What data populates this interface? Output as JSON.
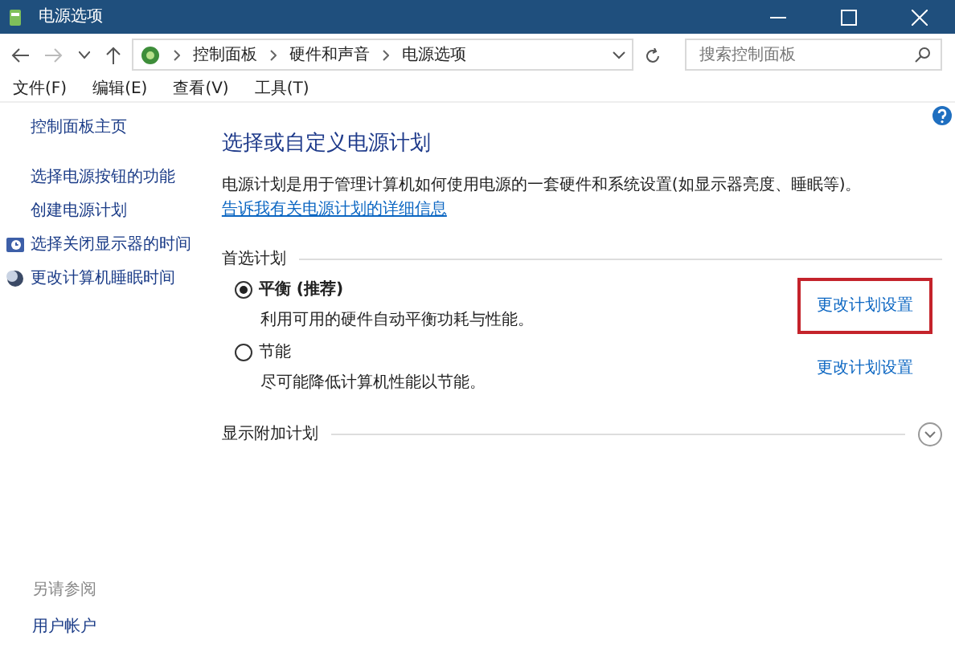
{
  "window": {
    "title": "电源选项"
  },
  "address_bar": {
    "crumbs": [
      "控制面板",
      "硬件和声音",
      "电源选项"
    ]
  },
  "search": {
    "placeholder": "搜索控制面板"
  },
  "menu": [
    "文件(F)",
    "编辑(E)",
    "查看(V)",
    "工具(T)"
  ],
  "sidebar": {
    "items": [
      {
        "label": "控制面板主页",
        "kind": "plain"
      },
      {
        "label": "选择电源按钮的功能",
        "kind": "plain"
      },
      {
        "label": "创建电源计划",
        "kind": "plain"
      },
      {
        "label": "选择关闭显示器的时间",
        "kind": "monitor"
      },
      {
        "label": "更改计算机睡眠时间",
        "kind": "moon"
      }
    ],
    "see_also": "另请参阅",
    "see_also_items": [
      "用户帐户"
    ]
  },
  "heading": "选择或自定义电源计划",
  "description": "电源计划是用于管理计算机如何使用电源的一套硬件和系统设置(如显示器亮度、睡眠等)。",
  "description_link": "告诉我有关电源计划的详细信息",
  "preferred_title": "首选计划",
  "plans": [
    {
      "name": "平衡 (推荐)",
      "description": "利用可用的硬件自动平衡功耗与性能。",
      "selected": true,
      "link": "更改计划设置",
      "highlighted": true
    },
    {
      "name": "节能",
      "description": "尽可能降低计算机性能以节能。",
      "selected": false,
      "link": "更改计划设置",
      "highlighted": false
    }
  ],
  "additional_title": "显示附加计划"
}
